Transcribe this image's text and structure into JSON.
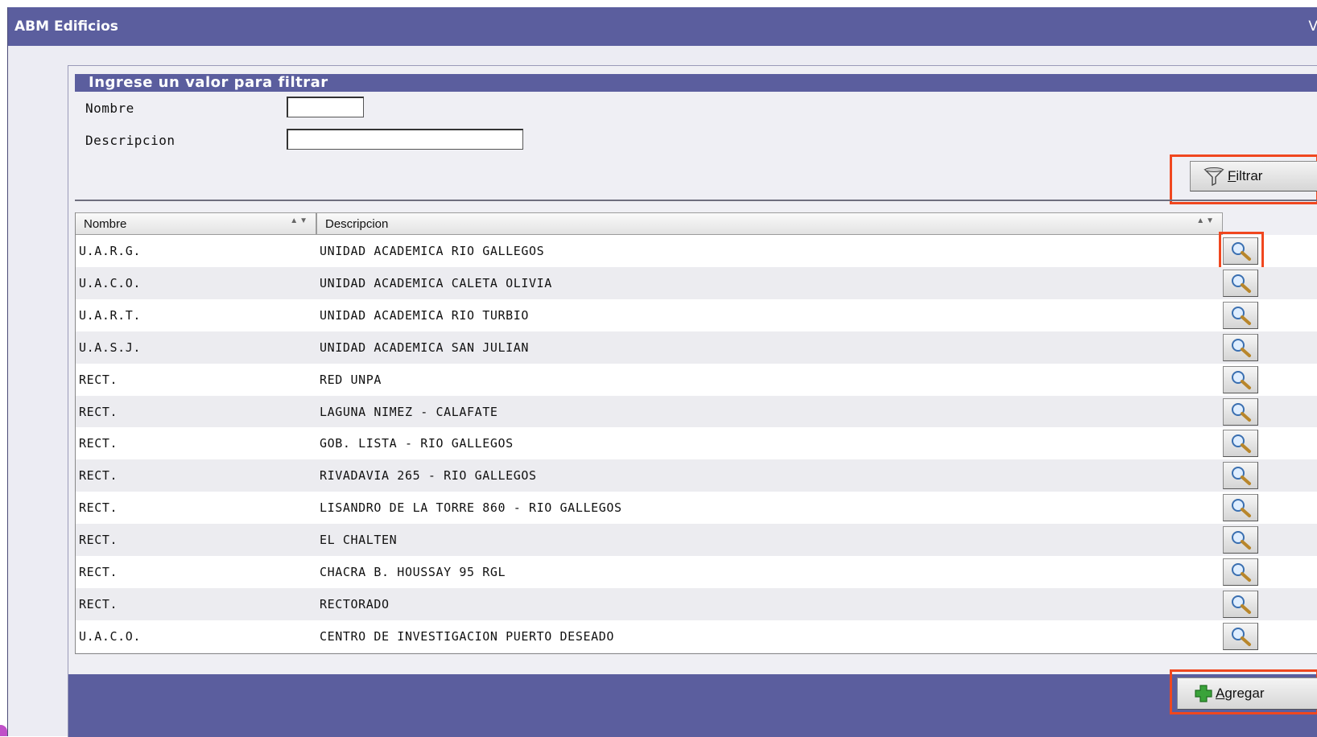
{
  "window": {
    "title": "ABM Edificios",
    "title_right": "V"
  },
  "filter": {
    "header": "Ingrese un valor para filtrar",
    "fields": [
      {
        "label": "Nombre",
        "value": ""
      },
      {
        "label": "Descripcion",
        "value": ""
      }
    ],
    "button": {
      "accel": "F",
      "rest": "iltrar",
      "icon": "funnel-icon"
    }
  },
  "grid": {
    "columns": [
      "Nombre",
      "Descripcion"
    ],
    "rows": [
      {
        "nombre": "U.A.R.G.",
        "descripcion": "UNIDAD ACADEMICA RIO GALLEGOS"
      },
      {
        "nombre": "U.A.C.O.",
        "descripcion": "UNIDAD ACADEMICA CALETA OLIVIA"
      },
      {
        "nombre": "U.A.R.T.",
        "descripcion": "UNIDAD ACADEMICA RIO TURBIO"
      },
      {
        "nombre": "U.A.S.J.",
        "descripcion": "UNIDAD ACADEMICA SAN JULIAN"
      },
      {
        "nombre": "RECT.",
        "descripcion": "RED UNPA"
      },
      {
        "nombre": "RECT.",
        "descripcion": "LAGUNA NIMEZ - CALAFATE"
      },
      {
        "nombre": "RECT.",
        "descripcion": "GOB. LISTA - RIO GALLEGOS"
      },
      {
        "nombre": "RECT.",
        "descripcion": "RIVADAVIA 265 - RIO GALLEGOS"
      },
      {
        "nombre": "RECT.",
        "descripcion": "LISANDRO DE LA TORRE 860 - RIO GALLEGOS"
      },
      {
        "nombre": "RECT.",
        "descripcion": "EL CHALTEN"
      },
      {
        "nombre": "RECT.",
        "descripcion": "CHACRA B. HOUSSAY 95 RGL"
      },
      {
        "nombre": "RECT.",
        "descripcion": "RECTORADO"
      },
      {
        "nombre": "U.A.C.O.",
        "descripcion": "CENTRO DE INVESTIGACION PUERTO DESEADO"
      }
    ],
    "row_action_icon": "magnifier-icon"
  },
  "footer": {
    "add_button": {
      "accel": "A",
      "rest": "gregar",
      "icon": "plus-icon"
    }
  },
  "colors": {
    "accent": "#5b5e9e",
    "highlight": "#f0471f"
  }
}
